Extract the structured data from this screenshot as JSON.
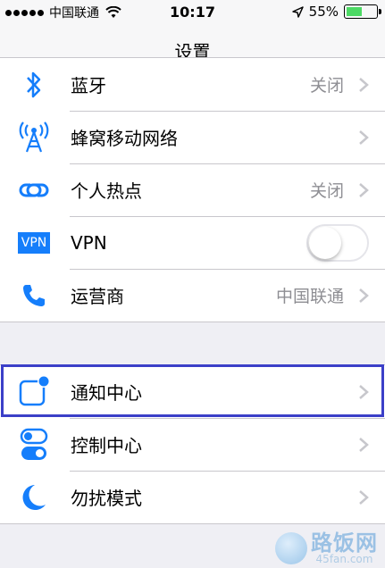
{
  "status_bar": {
    "carrier": "中国联通",
    "time": "10:17",
    "battery_percent": "55%",
    "battery_level": 0.55
  },
  "nav": {
    "title": "设置"
  },
  "network_group": [
    {
      "label": "蓝牙",
      "detail": "关闭",
      "icon": "bluetooth-icon"
    },
    {
      "label": "蜂窝移动网络",
      "detail": "",
      "icon": "cellular-icon"
    },
    {
      "label": "个人热点",
      "detail": "关闭",
      "icon": "hotspot-icon"
    },
    {
      "label": "VPN",
      "toggle_on": false,
      "icon": "vpn-icon",
      "icon_text": "VPN"
    },
    {
      "label": "运营商",
      "detail": "中国联通",
      "icon": "phone-icon"
    }
  ],
  "system_group": [
    {
      "label": "通知中心",
      "icon": "notification-center-icon"
    },
    {
      "label": "控制中心",
      "icon": "control-center-icon"
    },
    {
      "label": "勿扰模式",
      "icon": "moon-icon"
    }
  ],
  "watermark": {
    "name": "路饭网",
    "url": "45fan.com"
  },
  "colors": {
    "accent": "#157efb",
    "highlight_border": "#3b3fc8",
    "battery_fill": "#4cd964",
    "background": "#efeff4"
  }
}
